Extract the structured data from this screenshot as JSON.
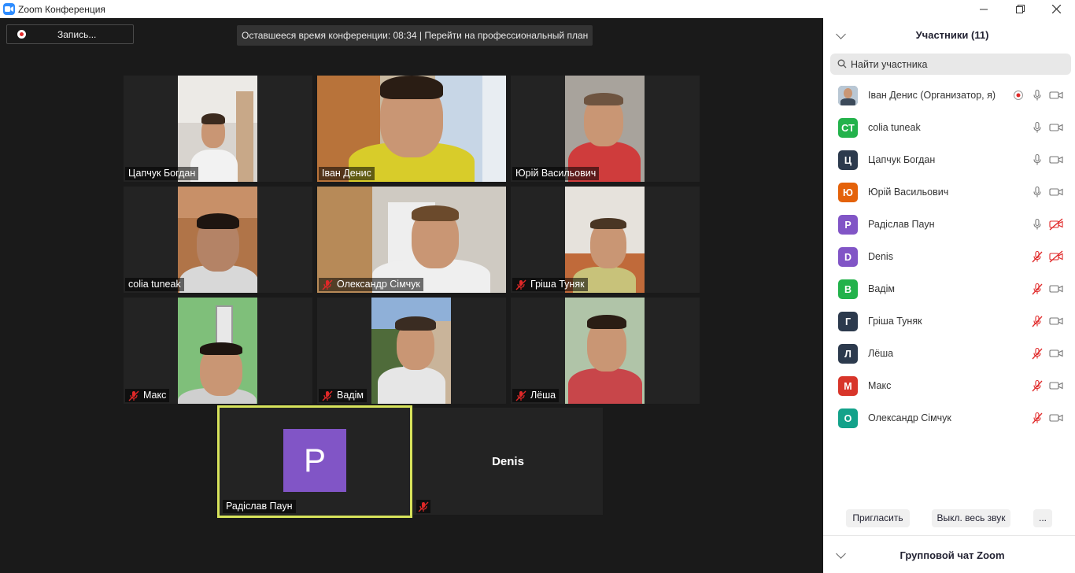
{
  "window": {
    "title": "Zoom Конференция"
  },
  "toolbar": {
    "record_label": "Запись..."
  },
  "banner": {
    "text": "Оставшееся время конференции: 08:34 | Перейти на профессиональный план"
  },
  "tiles": [
    {
      "name": "Цапчук Богдан",
      "muted": false
    },
    {
      "name": "Іван Денис",
      "muted": false
    },
    {
      "name": "Юрій Васильович",
      "muted": false
    },
    {
      "name": "colia tuneak",
      "muted": false
    },
    {
      "name": "Олександр Сімчук",
      "muted": true
    },
    {
      "name": "Гріша Туняк",
      "muted": true
    },
    {
      "name": "Макс",
      "muted": true
    },
    {
      "name": "Вадім",
      "muted": true
    },
    {
      "name": "Лёша",
      "muted": true
    }
  ],
  "speaker_tile": {
    "initial": "P",
    "name": "Радіслав Паун",
    "avatar_color": "#8155c6",
    "border_color": "#d7e35b"
  },
  "denis_tile": {
    "name": "Denis"
  },
  "panel": {
    "title": "Участники (11)",
    "search_placeholder": "Найти участника",
    "participants": [
      {
        "initials": "",
        "name": "Іван Денис (Организатор, я)",
        "color": "#6b8aa6",
        "mic": "on",
        "video": "on",
        "recording": true,
        "photo": true
      },
      {
        "initials": "CT",
        "name": "colia tuneak",
        "color": "#23b24b",
        "mic": "on",
        "video": "on"
      },
      {
        "initials": "Ц",
        "name": "Цапчук Богдан",
        "color": "#2c3a4d",
        "mic": "on",
        "video": "on"
      },
      {
        "initials": "Ю",
        "name": "Юрій Васильович",
        "color": "#e4620a",
        "mic": "on",
        "video": "on"
      },
      {
        "initials": "Р",
        "name": "Радіслав Паун",
        "color": "#8155c6",
        "mic": "on",
        "video": "off"
      },
      {
        "initials": "D",
        "name": "Denis",
        "color": "#8155c6",
        "mic": "off",
        "video": "off"
      },
      {
        "initials": "В",
        "name": "Вадім",
        "color": "#23b24b",
        "mic": "off",
        "video": "on"
      },
      {
        "initials": "Г",
        "name": "Гріша Туняк",
        "color": "#2c3a4d",
        "mic": "off",
        "video": "on"
      },
      {
        "initials": "Л",
        "name": "Лёша",
        "color": "#2c3a4d",
        "mic": "off",
        "video": "on"
      },
      {
        "initials": "М",
        "name": "Макс",
        "color": "#d8352a",
        "mic": "off",
        "video": "on"
      },
      {
        "initials": "О",
        "name": "Олександр Сімчук",
        "color": "#13a28a",
        "mic": "off",
        "video": "on"
      }
    ],
    "invite_label": "Пригласить",
    "mute_all_label": "Выкл. весь звук",
    "more_label": "...",
    "chat_title": "Групповой чат Zoom"
  },
  "colors": {
    "accent": "#2d8cff",
    "muted_red": "#e02828",
    "stage_bg": "#1a1a1a",
    "panel_bg": "#ffffff"
  },
  "icons": [
    "zoom-app-icon",
    "minimize-icon",
    "restore-icon",
    "close-icon",
    "record-icon",
    "mic-off-icon",
    "search-icon",
    "chevron-down-icon",
    "microphone-icon",
    "camera-icon",
    "camera-off-icon",
    "recording-icon"
  ]
}
